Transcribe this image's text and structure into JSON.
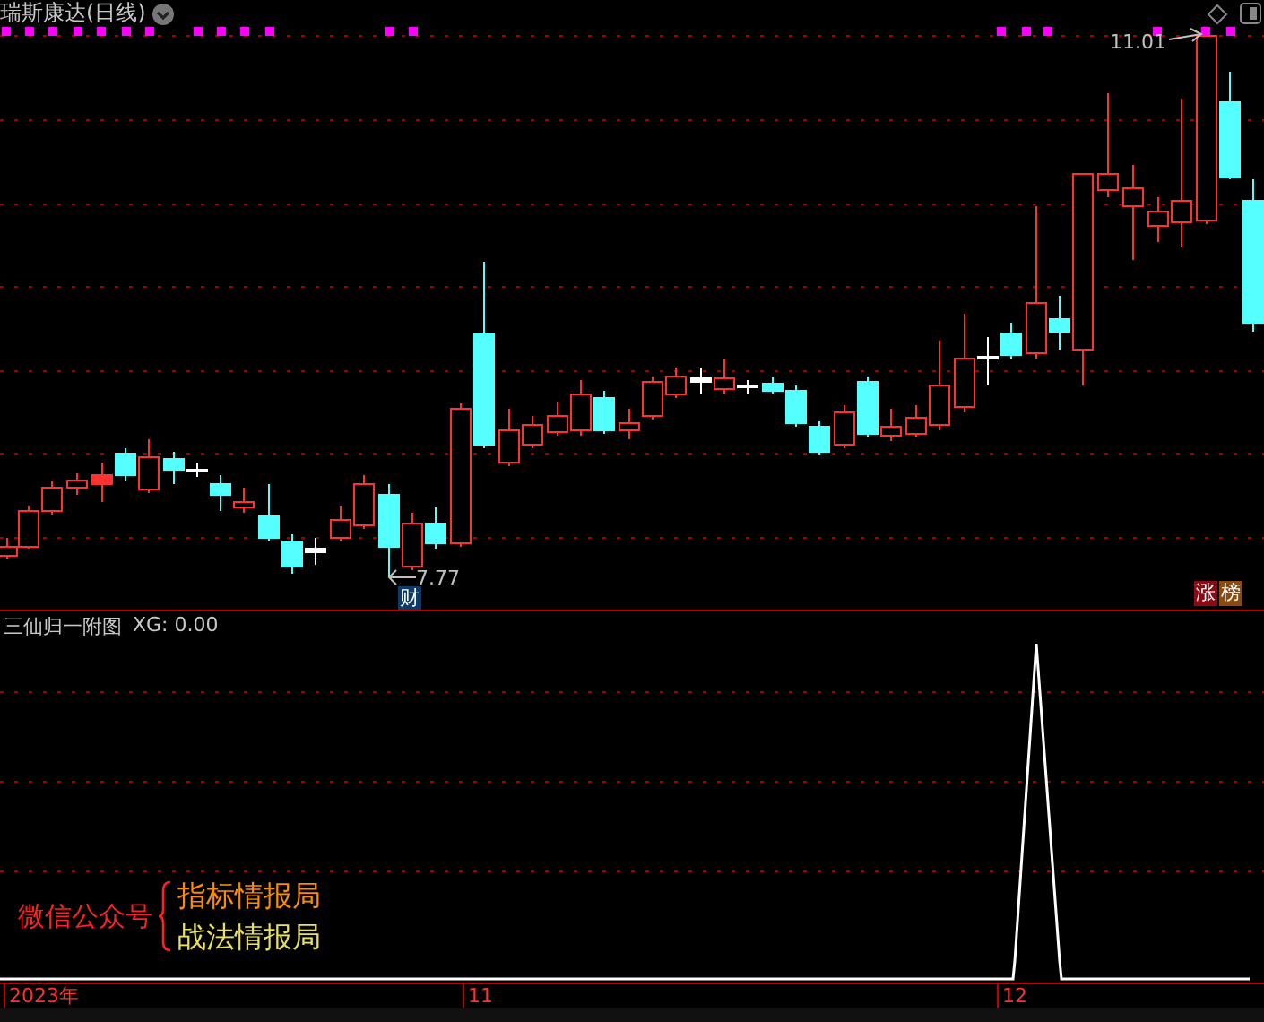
{
  "main_chart": {
    "title": "瑞斯康达(日线)",
    "high_label": "11.01",
    "low_label": "7.77",
    "event_badge": "财",
    "badges": [
      {
        "text": "涨",
        "color": "#8b0a14"
      },
      {
        "text": "榜",
        "color": "#8a4a10"
      }
    ]
  },
  "indicator": {
    "title": "三仙归一附图",
    "reading": "XG: 0.00",
    "promo": {
      "label": "微信公众号",
      "lines": [
        {
          "text": "指标情报局",
          "color": "#ff8c00"
        },
        {
          "text": "战法情报局",
          "color": "#e8e060"
        }
      ]
    }
  },
  "x_axis": {
    "labels": [
      "2023年",
      "11",
      "12"
    ]
  }
}
